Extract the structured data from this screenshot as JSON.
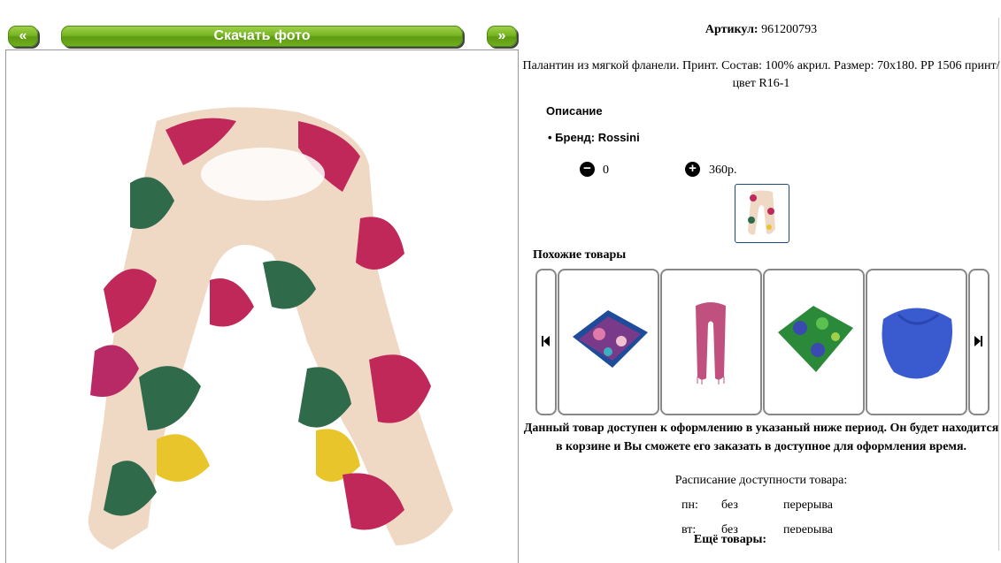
{
  "nav": {
    "prev_label": "«",
    "download_label": "Скачать фото",
    "next_label": "»"
  },
  "product": {
    "article_label": "Артикул:",
    "article_value": "961200793",
    "description": "Палантин из мягкой фланели. Принт. Состав: 100% акрил. Размер: 70x180. PP 1506 принт/цвет R16-1",
    "section_title": "Описание",
    "brand": "Бренд: Rossini",
    "quantity": "0",
    "price": "360р."
  },
  "similar": {
    "title": "Похожие товары",
    "items": [
      {
        "name": "paisley-square-scarf"
      },
      {
        "name": "pink-long-scarf"
      },
      {
        "name": "green-floral-square-scarf"
      },
      {
        "name": "blue-square-scarf"
      }
    ]
  },
  "availability": {
    "notice": "Данный товар доступен к оформлению в указаный ниже период. Он будет находится в корзине и Вы сможете его заказать в доступное для оформления время.",
    "schedule_title": "Расписание доступности товара:",
    "rows": [
      {
        "day": "пн:",
        "a": "без",
        "b": "перерыва"
      },
      {
        "day": "вт:",
        "a": "без",
        "b": "перерыва"
      }
    ]
  },
  "more_title": "Ещё товары:"
}
